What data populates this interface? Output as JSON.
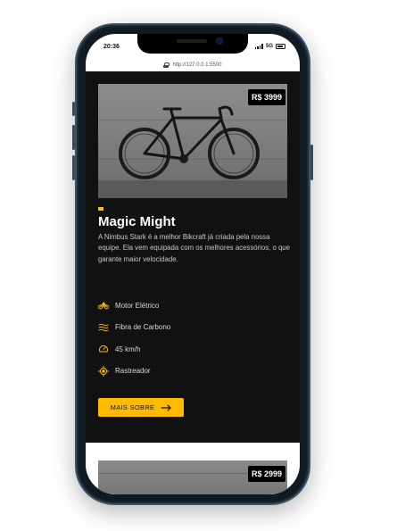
{
  "status_bar": {
    "time": "20:36",
    "network": "5G"
  },
  "browser": {
    "url": "http://127.0.0.1:5500"
  },
  "product": {
    "price": "R$ 3999",
    "title": "Magic Might",
    "description": "A Nimbus Stark é a melhor Bikcraft já criada pela nossa equipe. Ela vem equipada com os melhores acessórios, o que garante maior velocidade.",
    "features": [
      {
        "icon": "electric-motor-icon",
        "label": "Motor Elétrico"
      },
      {
        "icon": "carbon-fiber-icon",
        "label": "Fibra de Carbono"
      },
      {
        "icon": "speedometer-icon",
        "label": "45 km/h"
      },
      {
        "icon": "tracker-icon",
        "label": "Rastreador"
      }
    ],
    "button_label": "MAIS SOBRE"
  },
  "next_product": {
    "price": "R$ 2999"
  },
  "colors": {
    "accent": "#ffbb00",
    "card_background": "#111111"
  }
}
